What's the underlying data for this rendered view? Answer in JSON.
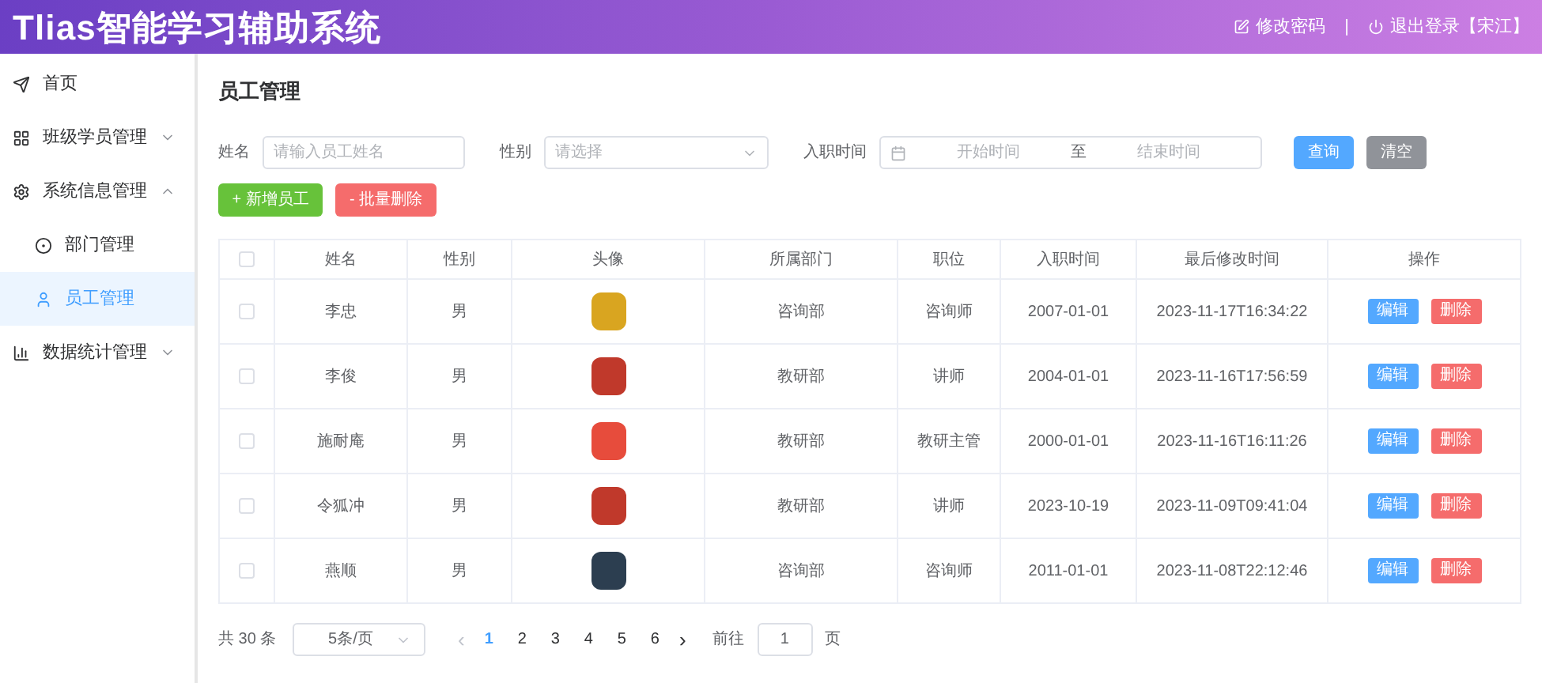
{
  "header": {
    "title": "Tlias智能学习辅助系统",
    "separator": "|",
    "links": [
      {
        "kind": "edit",
        "label": "修改密码"
      },
      {
        "kind": "power",
        "label": "退出登录【宋江】"
      }
    ]
  },
  "sidebar": {
    "items": [
      {
        "kind": "send",
        "label": "首页",
        "selected": false
      },
      {
        "kind": "grid",
        "label": "班级学员管理",
        "selected": false,
        "expanded": false
      },
      {
        "kind": "gear",
        "label": "系统信息管理",
        "selected": false,
        "expanded": true,
        "children": [
          {
            "kind": "dept",
            "label": "部门管理",
            "selected": false
          },
          {
            "kind": "user",
            "label": "员工管理",
            "selected": true
          }
        ]
      },
      {
        "kind": "chart",
        "label": "数据统计管理",
        "selected": false,
        "expanded": false
      }
    ]
  },
  "page_title": "员工管理",
  "filters": {
    "name": {
      "label": "姓名",
      "placeholder": "请输入员工姓名"
    },
    "gender": {
      "label": "性别",
      "placeholder": "请选择"
    },
    "date": {
      "label": "入职时间",
      "start_placeholder": "开始时间",
      "separator": "至",
      "end_placeholder": "结束时间"
    },
    "query_button": "查询",
    "clear_button": "清空"
  },
  "actions": {
    "add": "+ 新增员工",
    "batch_delete": "- 批量删除"
  },
  "table": {
    "select_all_checked": false,
    "columns": [
      "姓名",
      "性别",
      "头像",
      "所属部门",
      "职位",
      "入职时间",
      "最后修改时间",
      "操作"
    ],
    "rows": [
      {
        "checked": false,
        "name": "李忠",
        "gender": "男",
        "dept": "咨询部",
        "job": "咨询师",
        "entry": "2007-01-01",
        "updated": "2023-11-17T16:34:22",
        "edit": "编辑",
        "delete": "删除"
      },
      {
        "checked": false,
        "name": "李俊",
        "gender": "男",
        "dept": "教研部",
        "job": "讲师",
        "entry": "2004-01-01",
        "updated": "2023-11-16T17:56:59",
        "edit": "编辑",
        "delete": "删除"
      },
      {
        "checked": false,
        "name": "施耐庵",
        "gender": "男",
        "dept": "教研部",
        "job": "教研主管",
        "entry": "2000-01-01",
        "updated": "2023-11-16T16:11:26",
        "edit": "编辑",
        "delete": "删除"
      },
      {
        "checked": false,
        "name": "令狐冲",
        "gender": "男",
        "dept": "教研部",
        "job": "讲师",
        "entry": "2023-10-19",
        "updated": "2023-11-09T09:41:04",
        "edit": "编辑",
        "delete": "删除"
      },
      {
        "checked": false,
        "name": "燕顺",
        "gender": "男",
        "dept": "咨询部",
        "job": "咨询师",
        "entry": "2011-01-01",
        "updated": "2023-11-08T22:12:46",
        "edit": "编辑",
        "delete": "删除"
      }
    ]
  },
  "pagination": {
    "total": "共 30 条",
    "page_size": "5条/页",
    "prev": "‹",
    "pages": [
      {
        "label": "1",
        "selected": true
      },
      {
        "label": "2",
        "selected": false
      },
      {
        "label": "3",
        "selected": false
      },
      {
        "label": "4",
        "selected": false
      },
      {
        "label": "5",
        "selected": false
      },
      {
        "label": "6",
        "selected": false
      }
    ],
    "next": "›",
    "goto_label": "前往",
    "goto_value": "1",
    "goto_suffix": "页"
  }
}
